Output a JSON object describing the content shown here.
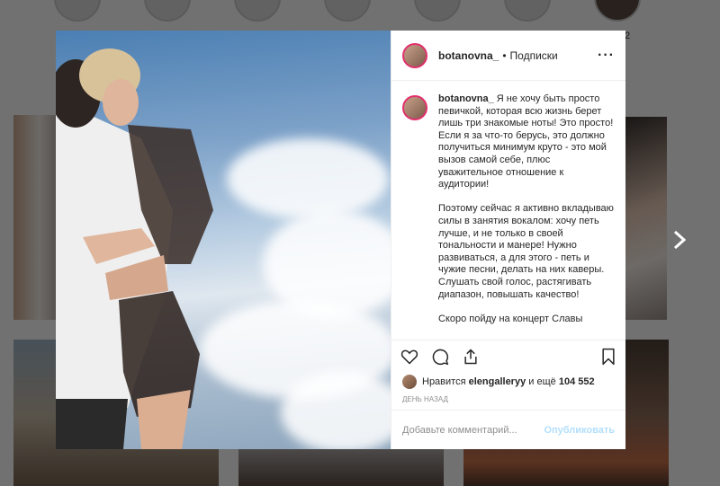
{
  "header": {
    "username": "botanovna_",
    "separator": "•",
    "follow_label": "Подписки",
    "more_label": "···"
  },
  "caption": {
    "username": "botanovna_",
    "text": "Я не хочу быть просто певичкой, которая всю жизнь берет лишь три знакомые ноты! Это просто!\nЕсли я за что-то берусь, это должно получиться минимум круто - это мой вызов самой себе, плюс уважительное отношение к аудитории!\n\nПоэтому сейчас я активно вкладываю силы в занятия вокалом: хочу петь лучше, и не только в своей тональности и манере! Нужно развиваться, а для этого - петь и чужие песни, делать на них каверы. Слушать свой голос, растягивать диапазон, повышать качество!\n\nСкоро пойду на концерт Славы"
  },
  "likes": {
    "prefix": "Нравится",
    "user": "elengalleryy",
    "conj": "и ещё",
    "count": "104 552"
  },
  "time_label": "ДЕНЬ НАЗАД",
  "comment": {
    "placeholder": "Добавьте комментарий...",
    "post_label": "Опубликовать"
  },
  "background": {
    "stray_text": "2"
  },
  "icons": {
    "like": "heart-icon",
    "comment": "comment-icon",
    "share": "share-icon",
    "save": "bookmark-icon",
    "next": "chevron-right-icon"
  },
  "colors": {
    "text": "#262626",
    "muted": "#8e8e8e",
    "post_disabled": "#b2dffc",
    "story_ring": "#e1306c"
  }
}
